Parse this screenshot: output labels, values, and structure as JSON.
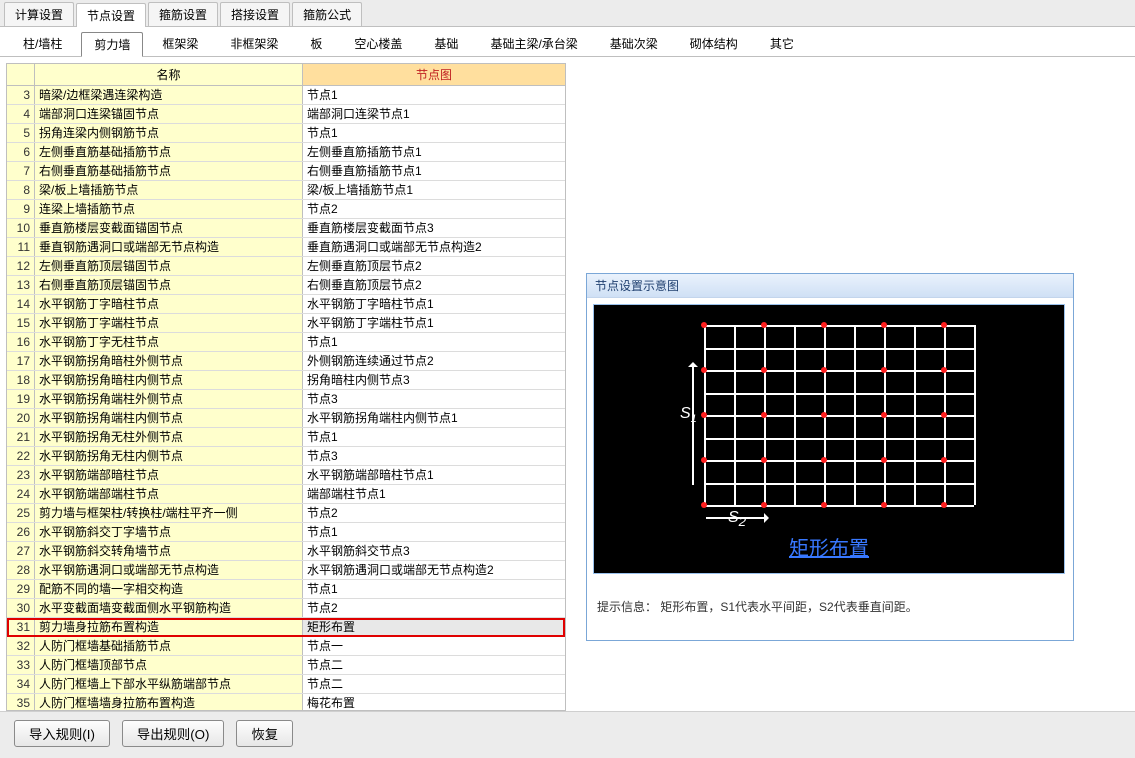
{
  "tabRow1": {
    "items": [
      "计算设置",
      "节点设置",
      "箍筋设置",
      "搭接设置",
      "箍筋公式"
    ],
    "activeIndex": 1
  },
  "tabRow2": {
    "items": [
      "柱/墙柱",
      "剪力墙",
      "框架梁",
      "非框架梁",
      "板",
      "空心楼盖",
      "基础",
      "基础主梁/承台梁",
      "基础次梁",
      "砌体结构",
      "其它"
    ],
    "activeIndex": 1
  },
  "table": {
    "headers": {
      "name": "名称",
      "diagram": "节点图"
    },
    "selectedNo": 31,
    "rows": [
      {
        "no": 3,
        "name": "暗梁/边框梁遇连梁构造",
        "diagram": "节点1"
      },
      {
        "no": 4,
        "name": "端部洞口连梁锚固节点",
        "diagram": "端部洞口连梁节点1"
      },
      {
        "no": 5,
        "name": "拐角连梁内侧钢筋节点",
        "diagram": "节点1"
      },
      {
        "no": 6,
        "name": "左侧垂直筋基础插筋节点",
        "diagram": "左侧垂直筋插筋节点1"
      },
      {
        "no": 7,
        "name": "右侧垂直筋基础插筋节点",
        "diagram": "右侧垂直筋插筋节点1"
      },
      {
        "no": 8,
        "name": "梁/板上墙插筋节点",
        "diagram": "梁/板上墙插筋节点1"
      },
      {
        "no": 9,
        "name": "连梁上墙插筋节点",
        "diagram": "节点2"
      },
      {
        "no": 10,
        "name": "垂直筋楼层变截面锚固节点",
        "diagram": "垂直筋楼层变截面节点3"
      },
      {
        "no": 11,
        "name": "垂直钢筋遇洞口或端部无节点构造",
        "diagram": "垂直筋遇洞口或端部无节点构造2"
      },
      {
        "no": 12,
        "name": "左侧垂直筋顶层锚固节点",
        "diagram": "左侧垂直筋顶层节点2"
      },
      {
        "no": 13,
        "name": "右侧垂直筋顶层锚固节点",
        "diagram": "右侧垂直筋顶层节点2"
      },
      {
        "no": 14,
        "name": "水平钢筋丁字暗柱节点",
        "diagram": "水平钢筋丁字暗柱节点1"
      },
      {
        "no": 15,
        "name": "水平钢筋丁字端柱节点",
        "diagram": "水平钢筋丁字端柱节点1"
      },
      {
        "no": 16,
        "name": "水平钢筋丁字无柱节点",
        "diagram": "节点1"
      },
      {
        "no": 17,
        "name": "水平钢筋拐角暗柱外侧节点",
        "diagram": "外侧钢筋连续通过节点2"
      },
      {
        "no": 18,
        "name": "水平钢筋拐角暗柱内侧节点",
        "diagram": "拐角暗柱内侧节点3"
      },
      {
        "no": 19,
        "name": "水平钢筋拐角端柱外侧节点",
        "diagram": "节点3"
      },
      {
        "no": 20,
        "name": "水平钢筋拐角端柱内侧节点",
        "diagram": "水平钢筋拐角端柱内侧节点1"
      },
      {
        "no": 21,
        "name": "水平钢筋拐角无柱外侧节点",
        "diagram": "节点1"
      },
      {
        "no": 22,
        "name": "水平钢筋拐角无柱内侧节点",
        "diagram": "节点3"
      },
      {
        "no": 23,
        "name": "水平钢筋端部暗柱节点",
        "diagram": "水平钢筋端部暗柱节点1"
      },
      {
        "no": 24,
        "name": "水平钢筋端部端柱节点",
        "diagram": "端部端柱节点1"
      },
      {
        "no": 25,
        "name": "剪力墙与框架柱/转换柱/端柱平齐一侧",
        "diagram": "节点2"
      },
      {
        "no": 26,
        "name": "水平钢筋斜交丁字墙节点",
        "diagram": "节点1"
      },
      {
        "no": 27,
        "name": "水平钢筋斜交转角墙节点",
        "diagram": "水平钢筋斜交节点3"
      },
      {
        "no": 28,
        "name": "水平钢筋遇洞口或端部无节点构造",
        "diagram": "水平钢筋遇洞口或端部无节点构造2"
      },
      {
        "no": 29,
        "name": "配筋不同的墙一字相交构造",
        "diagram": "节点1"
      },
      {
        "no": 30,
        "name": "水平变截面墙变截面侧水平钢筋构造",
        "diagram": "节点2"
      },
      {
        "no": 31,
        "name": "剪力墙身拉筋布置构造",
        "diagram": "矩形布置"
      },
      {
        "no": 32,
        "name": "人防门框墙基础插筋节点",
        "diagram": "节点一"
      },
      {
        "no": 33,
        "name": "人防门框墙顶部节点",
        "diagram": "节点二"
      },
      {
        "no": 34,
        "name": "人防门框墙上下部水平纵筋端部节点",
        "diagram": "节点二"
      },
      {
        "no": 35,
        "name": "人防门框墙墙身拉筋布置构造",
        "diagram": "梅花布置"
      }
    ]
  },
  "preview": {
    "groupTitle": "节点设置示意图",
    "caption": "矩形布置",
    "s1": "S",
    "s1sub": "1",
    "s2": "S",
    "s2sub": "2",
    "hintLabel": "提示信息：",
    "hintText": "矩形布置，S1代表水平间距，S2代表垂直间距。"
  },
  "buttons": {
    "import": "导入规则(I)",
    "export": "导出规则(O)",
    "restore": "恢复"
  }
}
